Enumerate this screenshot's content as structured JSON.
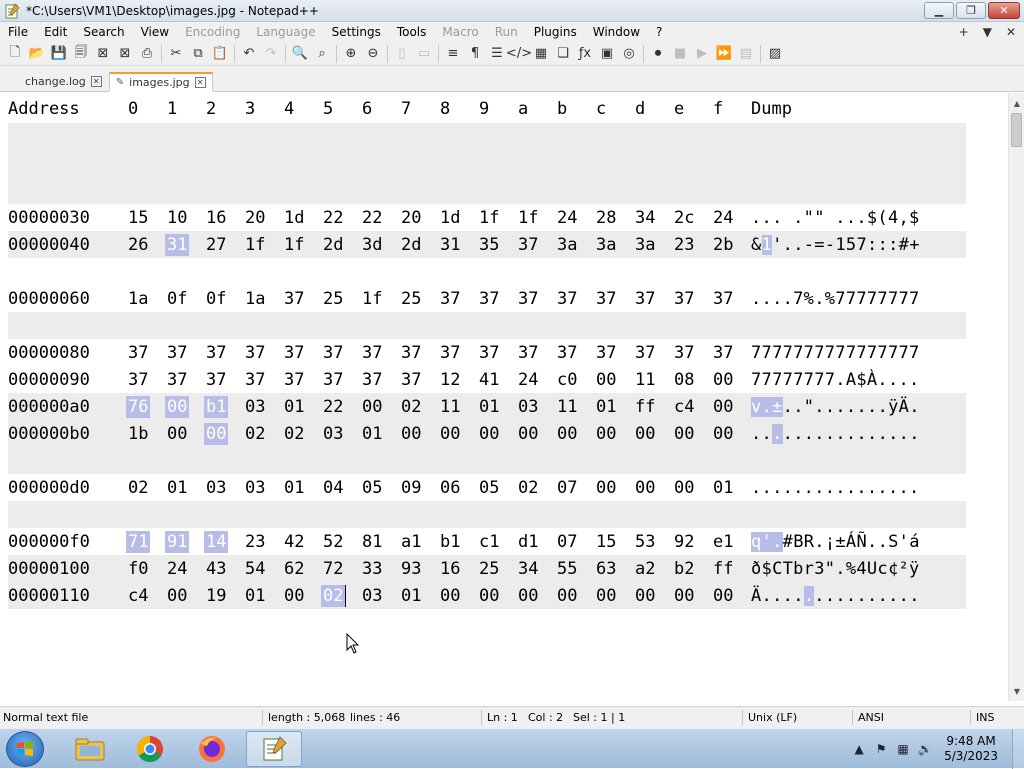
{
  "window": {
    "title": "*C:\\Users\\VM1\\Desktop\\images.jpg - Notepad++"
  },
  "menu": {
    "items": [
      {
        "label": "File",
        "enabled": true
      },
      {
        "label": "Edit",
        "enabled": true
      },
      {
        "label": "Search",
        "enabled": true
      },
      {
        "label": "View",
        "enabled": true
      },
      {
        "label": "Encoding",
        "enabled": false
      },
      {
        "label": "Language",
        "enabled": false
      },
      {
        "label": "Settings",
        "enabled": true
      },
      {
        "label": "Tools",
        "enabled": true
      },
      {
        "label": "Macro",
        "enabled": false
      },
      {
        "label": "Run",
        "enabled": false
      },
      {
        "label": "Plugins",
        "enabled": true
      },
      {
        "label": "Window",
        "enabled": true
      },
      {
        "label": "?",
        "enabled": true
      }
    ],
    "right": [
      "+",
      "▼",
      "✕"
    ]
  },
  "tabs": [
    {
      "label": "change.log",
      "active": false
    },
    {
      "label": "images.jpg",
      "active": true
    }
  ],
  "hex": {
    "headers": [
      "Address",
      "0",
      "1",
      "2",
      "3",
      "4",
      "5",
      "6",
      "7",
      "8",
      "9",
      "a",
      "b",
      "c",
      "d",
      "e",
      "f",
      "Dump"
    ],
    "rows": [
      {
        "addr": "",
        "bytes": [],
        "dump": ""
      },
      {
        "addr": "",
        "bytes": [],
        "dump": ""
      },
      {
        "addr": "",
        "bytes": [],
        "dump": ""
      },
      {
        "addr": "00000030",
        "bytes": [
          "15",
          "10",
          "16",
          "20",
          "1d",
          "22",
          "22",
          "20",
          "1d",
          "1f",
          "1f",
          "24",
          "28",
          "34",
          "2c",
          "24"
        ],
        "dump": "... .\"\" ...$(4,$",
        "sel": [],
        "dumpsel": []
      },
      {
        "addr": "00000040",
        "bytes": [
          "26",
          "31",
          "27",
          "1f",
          "1f",
          "2d",
          "3d",
          "2d",
          "31",
          "35",
          "37",
          "3a",
          "3a",
          "3a",
          "23",
          "2b"
        ],
        "dump": "&1'..-=-157:::#+",
        "sel": [
          1
        ],
        "dumpsel": [
          1
        ]
      },
      {
        "addr": "",
        "bytes": [],
        "dump": ""
      },
      {
        "addr": "00000060",
        "bytes": [
          "1a",
          "0f",
          "0f",
          "1a",
          "37",
          "25",
          "1f",
          "25",
          "37",
          "37",
          "37",
          "37",
          "37",
          "37",
          "37",
          "37"
        ],
        "dump": "....7%.%77777777",
        "sel": [],
        "dumpsel": []
      },
      {
        "addr": "",
        "bytes": [],
        "dump": ""
      },
      {
        "addr": "00000080",
        "bytes": [
          "37",
          "37",
          "37",
          "37",
          "37",
          "37",
          "37",
          "37",
          "37",
          "37",
          "37",
          "37",
          "37",
          "37",
          "37",
          "37"
        ],
        "dump": "7777777777777777",
        "sel": [],
        "dumpsel": []
      },
      {
        "addr": "00000090",
        "bytes": [
          "37",
          "37",
          "37",
          "37",
          "37",
          "37",
          "37",
          "37",
          "12",
          "41",
          "24",
          "c0",
          "00",
          "11",
          "08",
          "00"
        ],
        "dump": "77777777.A$À....",
        "sel": [],
        "dumpsel": []
      },
      {
        "addr": "000000a0",
        "bytes": [
          "76",
          "00",
          "b1",
          "03",
          "01",
          "22",
          "00",
          "02",
          "11",
          "01",
          "03",
          "11",
          "01",
          "ff",
          "c4",
          "00"
        ],
        "dump": "v.±..\".......ÿÄ.",
        "sel": [
          0,
          1,
          2
        ],
        "dumpsel": [
          0,
          1,
          2
        ]
      },
      {
        "addr": "000000b0",
        "bytes": [
          "1b",
          "00",
          "00",
          "02",
          "02",
          "03",
          "01",
          "00",
          "00",
          "00",
          "00",
          "00",
          "00",
          "00",
          "00",
          "00"
        ],
        "dump": "................",
        "sel": [
          2
        ],
        "dumpsel": [
          2
        ]
      },
      {
        "addr": "",
        "bytes": [],
        "dump": ""
      },
      {
        "addr": "000000d0",
        "bytes": [
          "02",
          "01",
          "03",
          "03",
          "01",
          "04",
          "05",
          "09",
          "06",
          "05",
          "02",
          "07",
          "00",
          "00",
          "00",
          "01"
        ],
        "dump": "................",
        "sel": [],
        "dumpsel": []
      },
      {
        "addr": "",
        "bytes": [],
        "dump": ""
      },
      {
        "addr": "000000f0",
        "bytes": [
          "71",
          "91",
          "14",
          "23",
          "42",
          "52",
          "81",
          "a1",
          "b1",
          "c1",
          "d1",
          "07",
          "15",
          "53",
          "92",
          "e1"
        ],
        "dump": "q'.#BR.¡±ÁÑ..S'á",
        "sel": [
          0,
          1,
          2
        ],
        "dumpsel": [
          0,
          1,
          2
        ]
      },
      {
        "addr": "00000100",
        "bytes": [
          "f0",
          "24",
          "43",
          "54",
          "62",
          "72",
          "33",
          "93",
          "16",
          "25",
          "34",
          "55",
          "63",
          "a2",
          "b2",
          "ff"
        ],
        "dump": "ð$CTbr3\".%4Uc¢²ÿ",
        "sel": [],
        "dumpsel": []
      },
      {
        "addr": "00000110",
        "bytes": [
          "c4",
          "00",
          "19",
          "01",
          "00",
          "02",
          "03",
          "01",
          "00",
          "00",
          "00",
          "00",
          "00",
          "00",
          "00",
          "00"
        ],
        "dump": "Ä...............",
        "sel": [
          5
        ],
        "dumpsel": [
          5
        ]
      }
    ]
  },
  "status": {
    "type": "Normal text file",
    "length": "length : 5,068",
    "lines": "lines : 46",
    "ln": "Ln : 1",
    "col": "Col : 2",
    "sel": "Sel : 1 | 1",
    "eol": "Unix (LF)",
    "encoding": "ANSI",
    "mode": "INS"
  },
  "taskbar": {
    "time": "9:48 AM",
    "date": "5/3/2023"
  },
  "colors": {
    "selection": "#b7bde6",
    "shade": "#ececec",
    "tab_accent": "#f39c32"
  }
}
